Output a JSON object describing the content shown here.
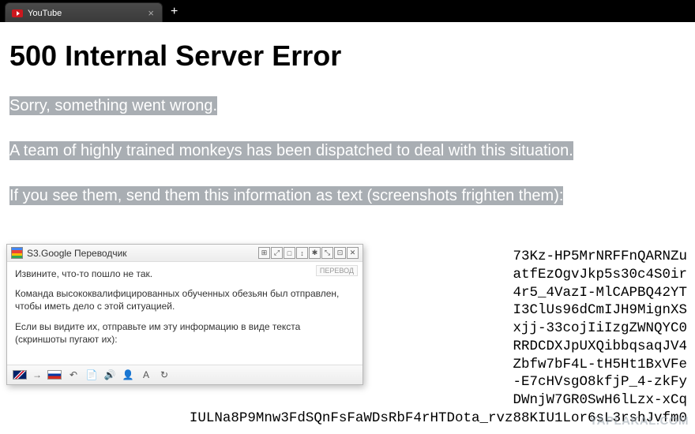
{
  "browser": {
    "tab_title": "YouTube",
    "new_tab_symbol": "+",
    "close_symbol": "×"
  },
  "error": {
    "heading": "500 Internal Server Error",
    "line1": "Sorry, something went wrong.",
    "line2": "A team of highly trained monkeys has been dispatched to deal with this situation.",
    "line3": "If you see them, send them this information as text (screenshots frighten them):",
    "code": "73Kz-HP5MrNRFFnQARNZu\natfEzOgvJkp5s30c4S0ir\n4r5_4VazI-MlCAPBQ42YT\nI3ClUs96dCmIJH9MignXS\nxjj-33cojIiIzgZWNQYC0\nRRDCDXJpUXQibbqsaqJV4\nZbfw7bF4L-tH5Ht1BxVFe\n-E7cHVsgO8kfjP_4-zkFy\nDWnjW7GR0SwH6lLzx-xCq\nIULNa8P9Mnw3FdSQnFsFaWDsRbF4rHTDota_rvz88KIU1Lor6sL3rshJvfm0"
  },
  "translator": {
    "title": "S3.Google Переводчик",
    "tag": "ПЕРЕВОД",
    "p1": "Извините, что-то пошло не так.",
    "p2": "Команда высококвалифицированных обученных обезьян был отправлен, чтобы иметь дело с этой ситуацией.",
    "p3": "Если вы видите их, отправьте им эту информацию в виде текста (скриншоты пугают их):",
    "head_icons": [
      "⊞",
      "⤢",
      "□",
      "↕",
      "✱",
      "⤡",
      "⊡",
      "✕"
    ],
    "foot_icons": [
      "↶",
      "📄",
      "🔊",
      "👤",
      "A",
      "↻"
    ]
  },
  "watermark": "YAPLAKAL.COM"
}
